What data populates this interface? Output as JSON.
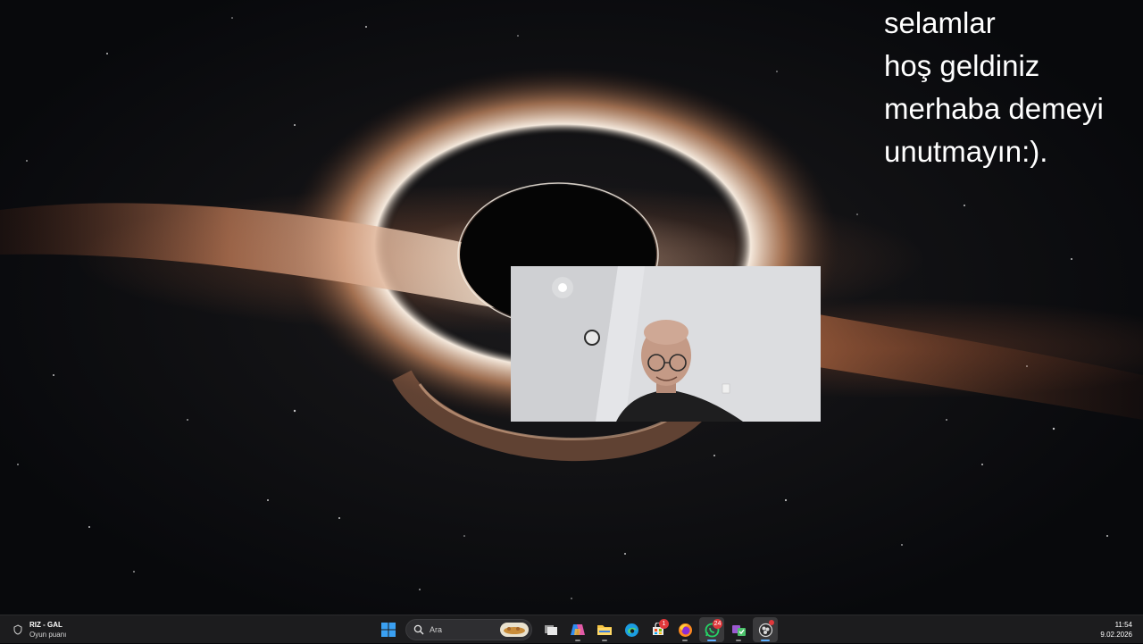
{
  "overlay": {
    "lines": [
      "selamlar",
      "hoş geldiniz",
      "merhaba demeyi",
      "unutmayın:)."
    ]
  },
  "webcam": {
    "name": "webcam-feed"
  },
  "taskbar": {
    "widget": {
      "title": "RIZ - GAL",
      "subtitle": "Oyun puanı",
      "icon": "shield-icon"
    },
    "search": {
      "placeholder": "Ara"
    },
    "apps": [
      {
        "name": "task-view",
        "icon": "task-view-icon"
      },
      {
        "name": "copilot",
        "icon": "copilot-icon"
      },
      {
        "name": "file-explorer",
        "icon": "folder-icon"
      },
      {
        "name": "edge",
        "icon": "edge-icon"
      },
      {
        "name": "store",
        "icon": "store-icon",
        "badge": "1"
      },
      {
        "name": "firefox",
        "icon": "firefox-icon"
      },
      {
        "name": "whatsapp",
        "icon": "whatsapp-icon",
        "badge": "24",
        "active": true
      },
      {
        "name": "tool-app",
        "icon": "tool-icon"
      },
      {
        "name": "obs",
        "icon": "record-icon",
        "active": true
      }
    ],
    "clock": {
      "time": "11:54",
      "date": "9.02.2026"
    }
  },
  "colors": {
    "taskbar_bg": "#1c1c1e",
    "active_indicator": "#5eb0ff",
    "badge": "#e0383b",
    "whatsapp": "#25d366"
  }
}
